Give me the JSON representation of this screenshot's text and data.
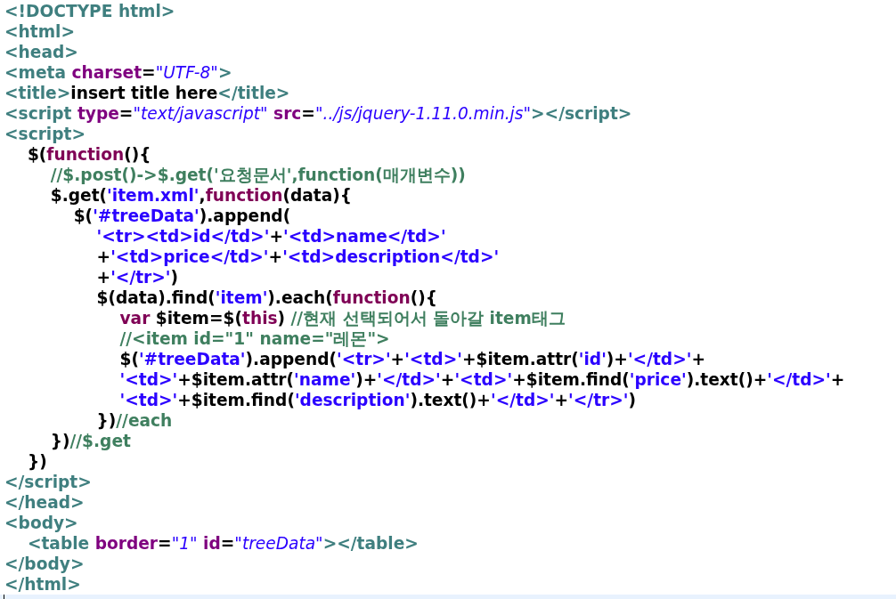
{
  "editor": {
    "cursor_on_last_line": true
  },
  "lines": [
    {
      "tokens": [
        {
          "kind": "tag",
          "text": "<!DOCTYPE html>"
        }
      ]
    },
    {
      "tokens": [
        {
          "kind": "tag",
          "text": "<html>"
        }
      ]
    },
    {
      "tokens": [
        {
          "kind": "tag",
          "text": "<head>"
        }
      ]
    },
    {
      "tokens": [
        {
          "kind": "tag",
          "text": "<meta"
        },
        {
          "kind": "attr",
          "text": " charset"
        },
        {
          "kind": "plain",
          "text": "="
        },
        {
          "kind": "value",
          "text": "\"UTF-8\""
        },
        {
          "kind": "tag",
          "text": ">"
        }
      ]
    },
    {
      "tokens": [
        {
          "kind": "tag",
          "text": "<title>"
        },
        {
          "kind": "plain",
          "text": "insert title here"
        },
        {
          "kind": "tag",
          "text": "</title>"
        }
      ]
    },
    {
      "tokens": [
        {
          "kind": "tag",
          "text": "<script"
        },
        {
          "kind": "attr",
          "text": " type"
        },
        {
          "kind": "plain",
          "text": "="
        },
        {
          "kind": "value",
          "text": "\"text/javascript\""
        },
        {
          "kind": "attr",
          "text": " src"
        },
        {
          "kind": "plain",
          "text": "="
        },
        {
          "kind": "value",
          "text": "\"../js/jquery-1.11.0.min.js\""
        },
        {
          "kind": "tag",
          "text": "></script>"
        }
      ]
    },
    {
      "tokens": [
        {
          "kind": "tag",
          "text": "<script>"
        }
      ]
    },
    {
      "tokens": [
        {
          "kind": "plain",
          "text": "    $("
        },
        {
          "kind": "keyword",
          "text": "function"
        },
        {
          "kind": "plain",
          "text": "(){"
        }
      ]
    },
    {
      "tokens": [
        {
          "kind": "comment",
          "text": "        //$.post()->$.get('요청문서',function(매개변수))"
        }
      ]
    },
    {
      "tokens": [
        {
          "kind": "plain",
          "text": "        $.get("
        },
        {
          "kind": "string",
          "text": "'item.xml'"
        },
        {
          "kind": "plain",
          "text": ","
        },
        {
          "kind": "keyword",
          "text": "function"
        },
        {
          "kind": "plain",
          "text": "(data){"
        }
      ]
    },
    {
      "tokens": [
        {
          "kind": "plain",
          "text": "            $("
        },
        {
          "kind": "string",
          "text": "'#treeData'"
        },
        {
          "kind": "plain",
          "text": ").append("
        }
      ]
    },
    {
      "tokens": [
        {
          "kind": "string",
          "text": "                '<tr><td>id</td>'"
        },
        {
          "kind": "plain",
          "text": "+"
        },
        {
          "kind": "string",
          "text": "'<td>name</td>'"
        }
      ]
    },
    {
      "tokens": [
        {
          "kind": "plain",
          "text": "                +"
        },
        {
          "kind": "string",
          "text": "'<td>price</td>'"
        },
        {
          "kind": "plain",
          "text": "+"
        },
        {
          "kind": "string",
          "text": "'<td>description</td>'"
        }
      ]
    },
    {
      "tokens": [
        {
          "kind": "plain",
          "text": "                +"
        },
        {
          "kind": "string",
          "text": "'</tr>'"
        },
        {
          "kind": "plain",
          "text": ")"
        }
      ]
    },
    {
      "tokens": [
        {
          "kind": "plain",
          "text": "                $(data).find("
        },
        {
          "kind": "string",
          "text": "'item'"
        },
        {
          "kind": "plain",
          "text": ").each("
        },
        {
          "kind": "keyword",
          "text": "function"
        },
        {
          "kind": "plain",
          "text": "(){"
        }
      ]
    },
    {
      "tokens": [
        {
          "kind": "keyword",
          "text": "                    var"
        },
        {
          "kind": "plain",
          "text": " $item=$("
        },
        {
          "kind": "keyword",
          "text": "this"
        },
        {
          "kind": "plain",
          "text": ") "
        },
        {
          "kind": "comment",
          "text": "//현재 선택되어서 돌아갈 item태그"
        }
      ]
    },
    {
      "tokens": [
        {
          "kind": "comment",
          "text": "                    //<item id=\"1\" name=\"레몬\">"
        }
      ]
    },
    {
      "tokens": [
        {
          "kind": "plain",
          "text": "                    $("
        },
        {
          "kind": "string",
          "text": "'#treeData'"
        },
        {
          "kind": "plain",
          "text": ").append("
        },
        {
          "kind": "string",
          "text": "'<tr>'"
        },
        {
          "kind": "plain",
          "text": "+"
        },
        {
          "kind": "string",
          "text": "'<td>'"
        },
        {
          "kind": "plain",
          "text": "+$item.attr("
        },
        {
          "kind": "string",
          "text": "'id'"
        },
        {
          "kind": "plain",
          "text": ")+"
        },
        {
          "kind": "string",
          "text": "'</td>'"
        },
        {
          "kind": "plain",
          "text": "+"
        }
      ]
    },
    {
      "tokens": [
        {
          "kind": "string",
          "text": "                    '<td>'"
        },
        {
          "kind": "plain",
          "text": "+$item.attr("
        },
        {
          "kind": "string",
          "text": "'name'"
        },
        {
          "kind": "plain",
          "text": ")+"
        },
        {
          "kind": "string",
          "text": "'</td>'"
        },
        {
          "kind": "plain",
          "text": "+"
        },
        {
          "kind": "string",
          "text": "'<td>'"
        },
        {
          "kind": "plain",
          "text": "+$item.find("
        },
        {
          "kind": "string",
          "text": "'price'"
        },
        {
          "kind": "plain",
          "text": ").text()+"
        },
        {
          "kind": "string",
          "text": "'</td>'"
        },
        {
          "kind": "plain",
          "text": "+"
        }
      ]
    },
    {
      "tokens": [
        {
          "kind": "string",
          "text": "                    '<td>'"
        },
        {
          "kind": "plain",
          "text": "+$item.find("
        },
        {
          "kind": "string",
          "text": "'description'"
        },
        {
          "kind": "plain",
          "text": ").text()+"
        },
        {
          "kind": "string",
          "text": "'</td>'"
        },
        {
          "kind": "plain",
          "text": "+"
        },
        {
          "kind": "string",
          "text": "'</tr>'"
        },
        {
          "kind": "plain",
          "text": ")"
        }
      ]
    },
    {
      "tokens": [
        {
          "kind": "plain",
          "text": "                })"
        },
        {
          "kind": "comment",
          "text": "//each"
        }
      ]
    },
    {
      "tokens": [
        {
          "kind": "plain",
          "text": "        })"
        },
        {
          "kind": "comment",
          "text": "//$.get"
        }
      ]
    },
    {
      "tokens": [
        {
          "kind": "plain",
          "text": "    })"
        }
      ]
    },
    {
      "tokens": [
        {
          "kind": "tag",
          "text": "</script>"
        }
      ]
    },
    {
      "tokens": [
        {
          "kind": "tag",
          "text": "</head>"
        }
      ]
    },
    {
      "tokens": [
        {
          "kind": "tag",
          "text": "<body>"
        }
      ]
    },
    {
      "tokens": [
        {
          "kind": "tag",
          "text": "    <table"
        },
        {
          "kind": "attr",
          "text": " border"
        },
        {
          "kind": "plain",
          "text": "="
        },
        {
          "kind": "value",
          "text": "\"1\""
        },
        {
          "kind": "attr",
          "text": " id"
        },
        {
          "kind": "plain",
          "text": "="
        },
        {
          "kind": "value",
          "text": "\"treeData\""
        },
        {
          "kind": "tag",
          "text": "></table>"
        }
      ]
    },
    {
      "tokens": [
        {
          "kind": "tag",
          "text": "</body>"
        }
      ]
    },
    {
      "tokens": [
        {
          "kind": "tag",
          "text": "</html>"
        }
      ]
    }
  ]
}
